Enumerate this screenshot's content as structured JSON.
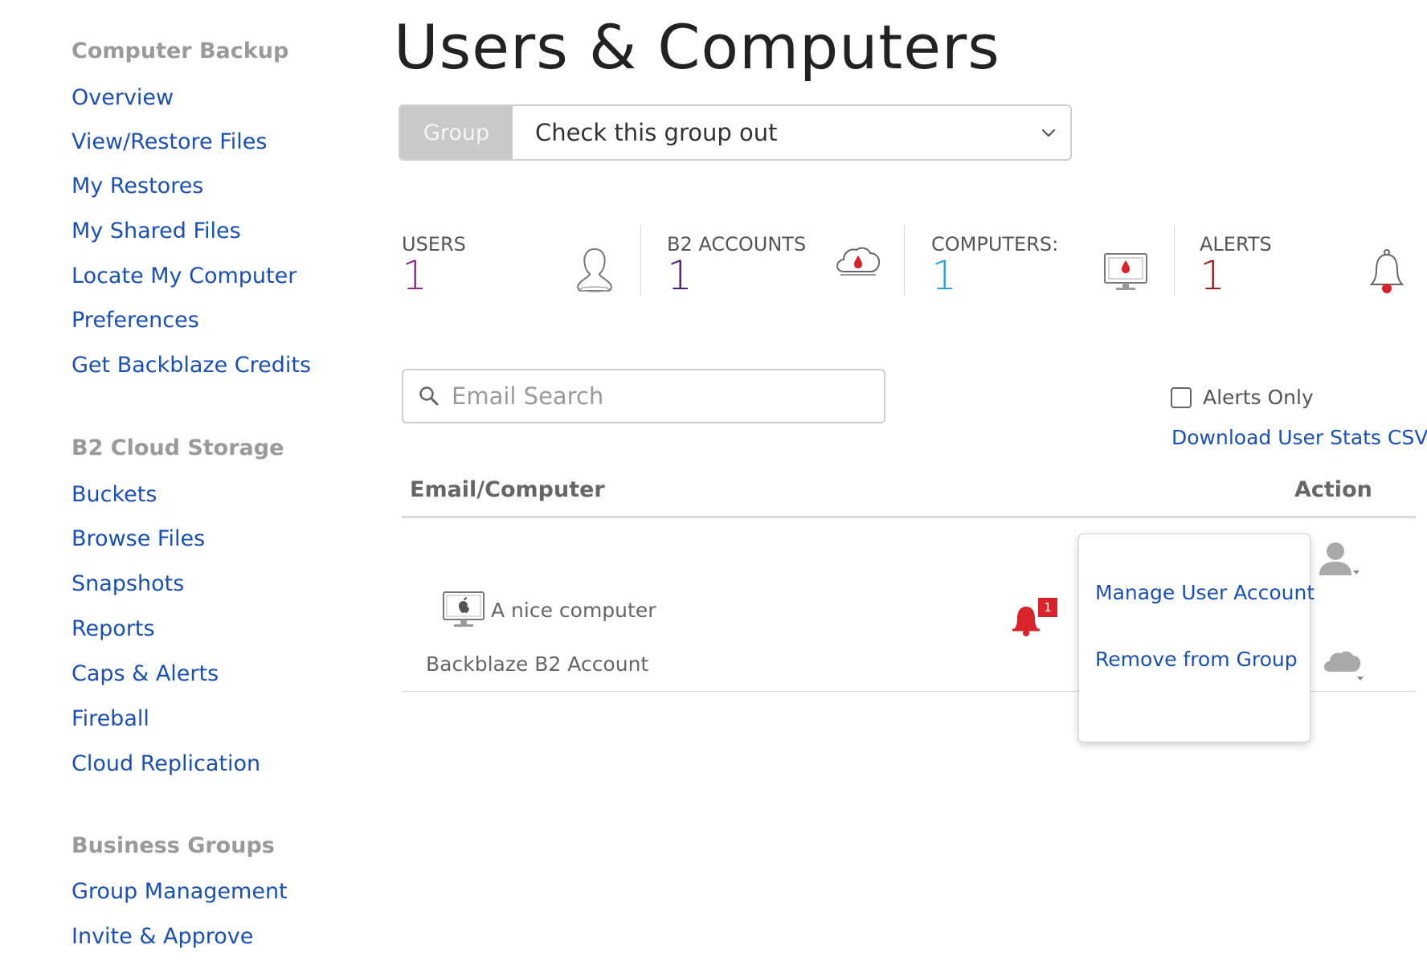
{
  "sidebar": {
    "sections": [
      {
        "title": "Computer Backup",
        "items": [
          "Overview",
          "View/Restore Files",
          "My Restores",
          "My Shared Files",
          "Locate My Computer",
          "Preferences",
          "Get Backblaze Credits"
        ]
      },
      {
        "title": "B2 Cloud Storage",
        "items": [
          "Buckets",
          "Browse Files",
          "Snapshots",
          "Reports",
          "Caps & Alerts",
          "Fireball",
          "Cloud Replication"
        ]
      },
      {
        "title": "Business Groups",
        "items": [
          "Group Management",
          "Invite & Approve"
        ]
      }
    ]
  },
  "page": {
    "title": "Users & Computers"
  },
  "group": {
    "label": "Group",
    "selected": "Check this group out"
  },
  "stats": [
    {
      "label": "USERS",
      "value": "1",
      "color": "#8a2a8e",
      "icon": "user-icon"
    },
    {
      "label": "B2 ACCOUNTS",
      "value": "1",
      "color": "#4b1f86",
      "icon": "cloud-icon"
    },
    {
      "label": "COMPUTERS:",
      "value": "1",
      "color": "#2d9fe0",
      "icon": "computer-icon"
    },
    {
      "label": "ALERTS",
      "value": "1",
      "color": "#9b1b1f",
      "icon": "bell-icon"
    }
  ],
  "search": {
    "placeholder": "Email Search"
  },
  "filters": {
    "alerts_only": "Alerts Only",
    "alerts_only_checked": false
  },
  "csv": {
    "link": "Download User Stats CSV"
  },
  "table": {
    "headers": {
      "email": "Email/Computer",
      "action": "Action"
    },
    "computer": "A nice computer",
    "b2_account": "Backblaze B2 Account",
    "alert_count": "1"
  },
  "action_menu": {
    "items": [
      "Manage User Account",
      "Remove from Group"
    ]
  },
  "colors": {
    "link": "#1a4fb8",
    "alert": "#d8232a",
    "brand": "#d8232a"
  }
}
